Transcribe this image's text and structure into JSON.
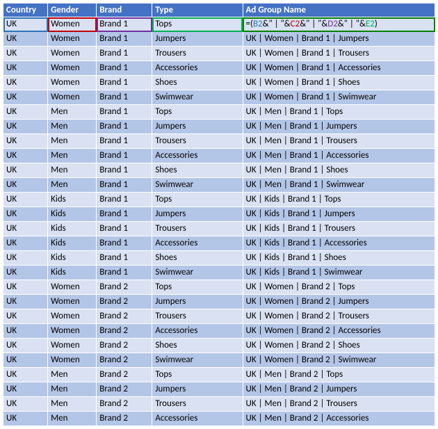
{
  "columns": {
    "country": "Country",
    "gender": "Gender",
    "brand": "Brand",
    "type": "Type",
    "adgroup": "Ad Group Name"
  },
  "formula": {
    "eq": "=(",
    "b2": "B2",
    "amp1": "&",
    "s1": "\" | \"",
    "amp2": "&",
    "c2": "C2",
    "amp3": "&",
    "s2": "\" | \"",
    "amp4": "&",
    "d2": "D2",
    "amp5": "&",
    "s3": "\" | \"",
    "amp6": "&",
    "e2": "E2",
    "close": ")"
  },
  "rows": [
    {
      "country": "UK",
      "gender": "Women",
      "brand": "Brand 1",
      "type": "Tops",
      "adgroup": "__FORMULA__"
    },
    {
      "country": "UK",
      "gender": "Women",
      "brand": "Brand 1",
      "type": "Jumpers",
      "adgroup": "UK | Women | Brand 1 | Jumpers"
    },
    {
      "country": "UK",
      "gender": "Women",
      "brand": "Brand 1",
      "type": "Trousers",
      "adgroup": "UK | Women | Brand 1 | Trousers"
    },
    {
      "country": "UK",
      "gender": "Women",
      "brand": "Brand 1",
      "type": "Accessories",
      "adgroup": "UK | Women | Brand 1 | Accessories"
    },
    {
      "country": "UK",
      "gender": "Women",
      "brand": "Brand 1",
      "type": "Shoes",
      "adgroup": "UK | Women | Brand 1 | Shoes"
    },
    {
      "country": "UK",
      "gender": "Women",
      "brand": "Brand 1",
      "type": "Swimwear",
      "adgroup": "UK | Women | Brand 1 | Swimwear"
    },
    {
      "country": "UK",
      "gender": "Men",
      "brand": "Brand 1",
      "type": "Tops",
      "adgroup": "UK | Men | Brand 1 | Tops"
    },
    {
      "country": "UK",
      "gender": "Men",
      "brand": "Brand 1",
      "type": "Jumpers",
      "adgroup": "UK | Men | Brand 1 | Jumpers"
    },
    {
      "country": "UK",
      "gender": "Men",
      "brand": "Brand 1",
      "type": "Trousers",
      "adgroup": "UK | Men | Brand 1 | Trousers"
    },
    {
      "country": "UK",
      "gender": "Men",
      "brand": "Brand 1",
      "type": "Accessories",
      "adgroup": "UK | Men | Brand 1 | Accessories"
    },
    {
      "country": "UK",
      "gender": "Men",
      "brand": "Brand 1",
      "type": "Shoes",
      "adgroup": "UK | Men | Brand 1 | Shoes"
    },
    {
      "country": "UK",
      "gender": "Men",
      "brand": "Brand 1",
      "type": "Swimwear",
      "adgroup": "UK | Men | Brand 1 | Swimwear"
    },
    {
      "country": "UK",
      "gender": "Kids",
      "brand": "Brand 1",
      "type": "Tops",
      "adgroup": "UK | Kids | Brand 1 | Tops"
    },
    {
      "country": "UK",
      "gender": "Kids",
      "brand": "Brand 1",
      "type": "Jumpers",
      "adgroup": "UK | Kids | Brand 1 | Jumpers"
    },
    {
      "country": "UK",
      "gender": "Kids",
      "brand": "Brand 1",
      "type": "Trousers",
      "adgroup": "UK | Kids | Brand 1 | Trousers"
    },
    {
      "country": "UK",
      "gender": "Kids",
      "brand": "Brand 1",
      "type": "Accessories",
      "adgroup": "UK | Kids | Brand 1 | Accessories"
    },
    {
      "country": "UK",
      "gender": "Kids",
      "brand": "Brand 1",
      "type": "Shoes",
      "adgroup": "UK | Kids | Brand 1 | Shoes"
    },
    {
      "country": "UK",
      "gender": "Kids",
      "brand": "Brand 1",
      "type": "Swimwear",
      "adgroup": "UK | Kids | Brand 1 | Swimwear"
    },
    {
      "country": "UK",
      "gender": "Women",
      "brand": "Brand 2",
      "type": "Tops",
      "adgroup": "UK | Women | Brand 2 | Tops"
    },
    {
      "country": "UK",
      "gender": "Women",
      "brand": "Brand 2",
      "type": "Jumpers",
      "adgroup": "UK | Women | Brand 2 | Jumpers"
    },
    {
      "country": "UK",
      "gender": "Women",
      "brand": "Brand 2",
      "type": "Trousers",
      "adgroup": "UK | Women | Brand 2 | Trousers"
    },
    {
      "country": "UK",
      "gender": "Women",
      "brand": "Brand 2",
      "type": "Accessories",
      "adgroup": "UK | Women | Brand 2 | Accessories"
    },
    {
      "country": "UK",
      "gender": "Women",
      "brand": "Brand 2",
      "type": "Shoes",
      "adgroup": "UK | Women | Brand 2 | Shoes"
    },
    {
      "country": "UK",
      "gender": "Women",
      "brand": "Brand 2",
      "type": "Swimwear",
      "adgroup": "UK | Women | Brand 2 | Swimwear"
    },
    {
      "country": "UK",
      "gender": "Men",
      "brand": "Brand 2",
      "type": "Tops",
      "adgroup": "UK | Men | Brand 2 | Tops"
    },
    {
      "country": "UK",
      "gender": "Men",
      "brand": "Brand 2",
      "type": "Jumpers",
      "adgroup": "UK | Men | Brand 2 | Jumpers"
    },
    {
      "country": "UK",
      "gender": "Men",
      "brand": "Brand 2",
      "type": "Trousers",
      "adgroup": "UK | Men | Brand 2 | Trousers"
    },
    {
      "country": "UK",
      "gender": "Men",
      "brand": "Brand 2",
      "type": "Accessories",
      "adgroup": "UK | Men | Brand 2 | Accessories"
    }
  ]
}
